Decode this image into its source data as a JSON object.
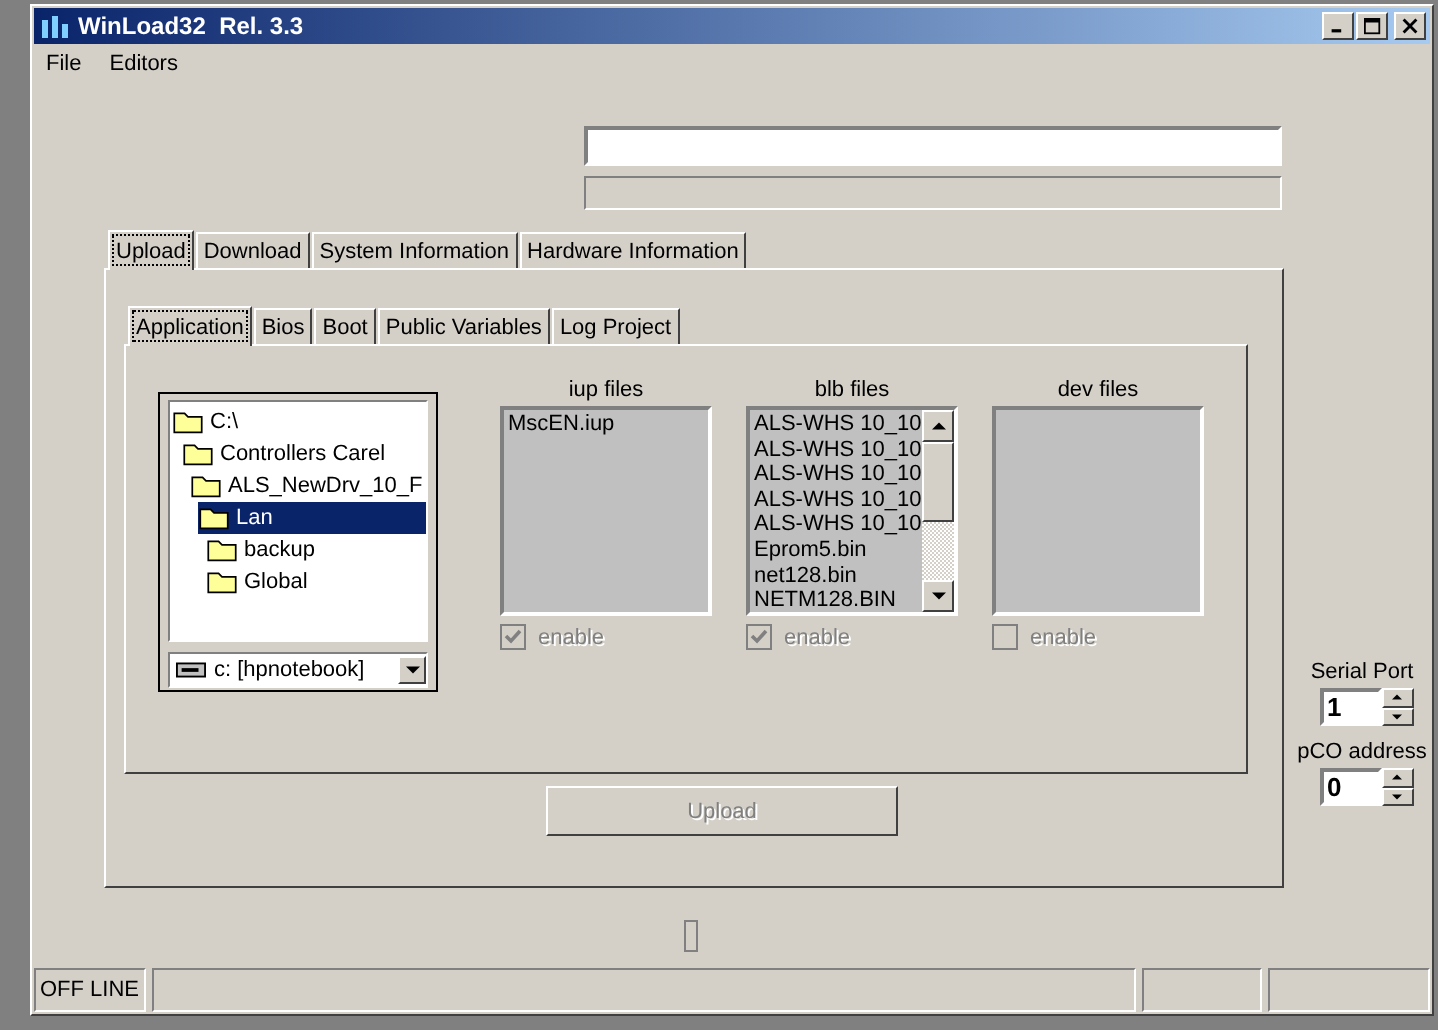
{
  "window": {
    "title": "WinLoad32  Rel. 3.3"
  },
  "menu": [
    "File",
    "Editors"
  ],
  "progress": {
    "level": 0
  },
  "outer_tabs": [
    {
      "label": "Upload",
      "selected": true
    },
    {
      "label": "Download",
      "selected": false
    },
    {
      "label": "System Information",
      "selected": false
    },
    {
      "label": "Hardware Information",
      "selected": false
    }
  ],
  "inner_tabs": [
    {
      "label": "Application",
      "selected": true
    },
    {
      "label": "Bios",
      "selected": false
    },
    {
      "label": "Boot",
      "selected": false
    },
    {
      "label": "Public Variables",
      "selected": false
    },
    {
      "label": "Log Project",
      "selected": false
    }
  ],
  "folder_tree": [
    {
      "label": "C:\\",
      "selected": false,
      "children": [
        {
          "label": "Controllers Carel",
          "selected": false,
          "children": [
            {
              "label": "ALS_NewDrv_10_F",
              "selected": false,
              "children": [
                {
                  "label": "Lan",
                  "selected": true,
                  "children": [
                    {
                      "label": "backup",
                      "selected": false
                    },
                    {
                      "label": "Global",
                      "selected": false
                    }
                  ]
                }
              ]
            }
          ]
        }
      ]
    }
  ],
  "drive_select": {
    "value": "c: [hpnotebook]"
  },
  "file_lists": [
    {
      "title": "iup files",
      "items": [
        "MscEN.iup"
      ],
      "scrollbar": false,
      "enable": {
        "label": "enable",
        "checked": true,
        "disabled": true
      }
    },
    {
      "title": "blb files",
      "items": [
        "ALS-WHS 10_10",
        "ALS-WHS 10_10",
        "ALS-WHS 10_10",
        "ALS-WHS 10_10",
        "ALS-WHS 10_10",
        "Eprom5.bin",
        "net128.bin",
        "NETM128.BIN"
      ],
      "scrollbar": true,
      "enable": {
        "label": "enable",
        "checked": true,
        "disabled": true
      }
    },
    {
      "title": "dev files",
      "scrollbar": false,
      "enable": {
        "label": "enable",
        "checked": false,
        "disabled": true
      }
    }
  ],
  "upload_button": {
    "label": "Upload",
    "disabled": true
  },
  "spinners": [
    {
      "label": "Serial Port",
      "value": "1"
    },
    {
      "label": "pCO address",
      "value": "0"
    }
  ],
  "status_bar": {
    "state": "OFF LINE"
  }
}
